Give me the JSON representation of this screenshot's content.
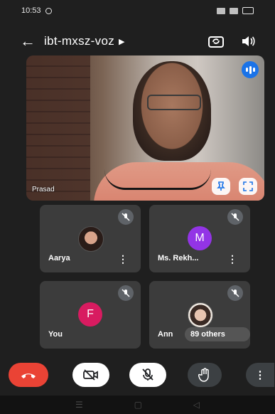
{
  "status_bar": {
    "time": "10:53"
  },
  "header": {
    "meeting_code": "ibt-mxsz-voz"
  },
  "main_video": {
    "speaker_name": "Prasad"
  },
  "participants": [
    {
      "name": "Aarya",
      "avatar": "photo",
      "muted": true
    },
    {
      "name": "Ms. Rekh...",
      "avatar_letter": "M",
      "avatar_color": "#9334e6",
      "muted": true
    },
    {
      "name": "You",
      "avatar_letter": "F",
      "avatar_color": "#d81b60",
      "muted": true
    },
    {
      "name": "Ann",
      "avatar": "photo",
      "muted": true,
      "others_label": "89 others"
    }
  ],
  "controls": {
    "end_call": "call-end-icon",
    "camera": "camera-off-icon",
    "mic": "mic-off-icon",
    "raise_hand": "hand-icon",
    "more": "more-vert-icon"
  },
  "colors": {
    "background": "#1f1f1f",
    "tile": "#3c3c3c",
    "end_call": "#ea4335",
    "accent_blue": "#1a73e8"
  }
}
